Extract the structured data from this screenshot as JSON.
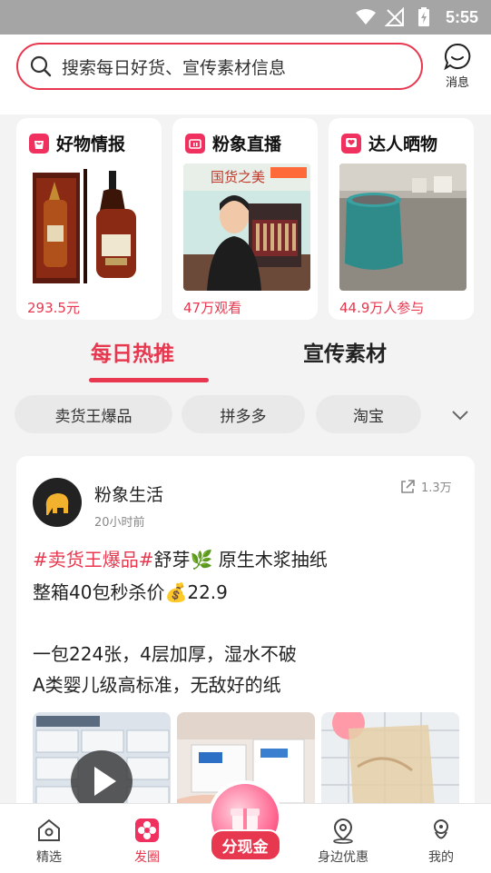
{
  "status_bar": {
    "time": "5:55"
  },
  "search": {
    "placeholder": "搜索每日好货、宣传素材信息"
  },
  "message": {
    "label": "消息"
  },
  "cards": [
    {
      "title": "好物情报",
      "footer": "293.5元"
    },
    {
      "title": "粉象直播",
      "footer": "47万观看",
      "image_caption": "国货之美"
    },
    {
      "title": "达人晒物",
      "footer": "44.9万人参与"
    }
  ],
  "tabs": [
    "每日热推",
    "宣传素材"
  ],
  "chips": [
    "卖货王爆品",
    "拼多多",
    "淘宝"
  ],
  "post": {
    "user": "粉象生活",
    "time": "20小时前",
    "shares": "1.3万",
    "tag": "#卖货王爆品#",
    "line1_rest": "舒芽🌿 原生木浆抽纸",
    "line2": "整箱40包秒杀价💰22.9",
    "line3": "一包224张，4层加厚，湿水不破",
    "line4": "A类婴儿级高标准，无敌好的纸"
  },
  "nav": {
    "items": [
      "精选",
      "发圈",
      "身边优惠",
      "我的"
    ],
    "center": "分现金"
  },
  "colors": {
    "accent": "#e8384f",
    "status_bar": "#a5a5a5"
  }
}
